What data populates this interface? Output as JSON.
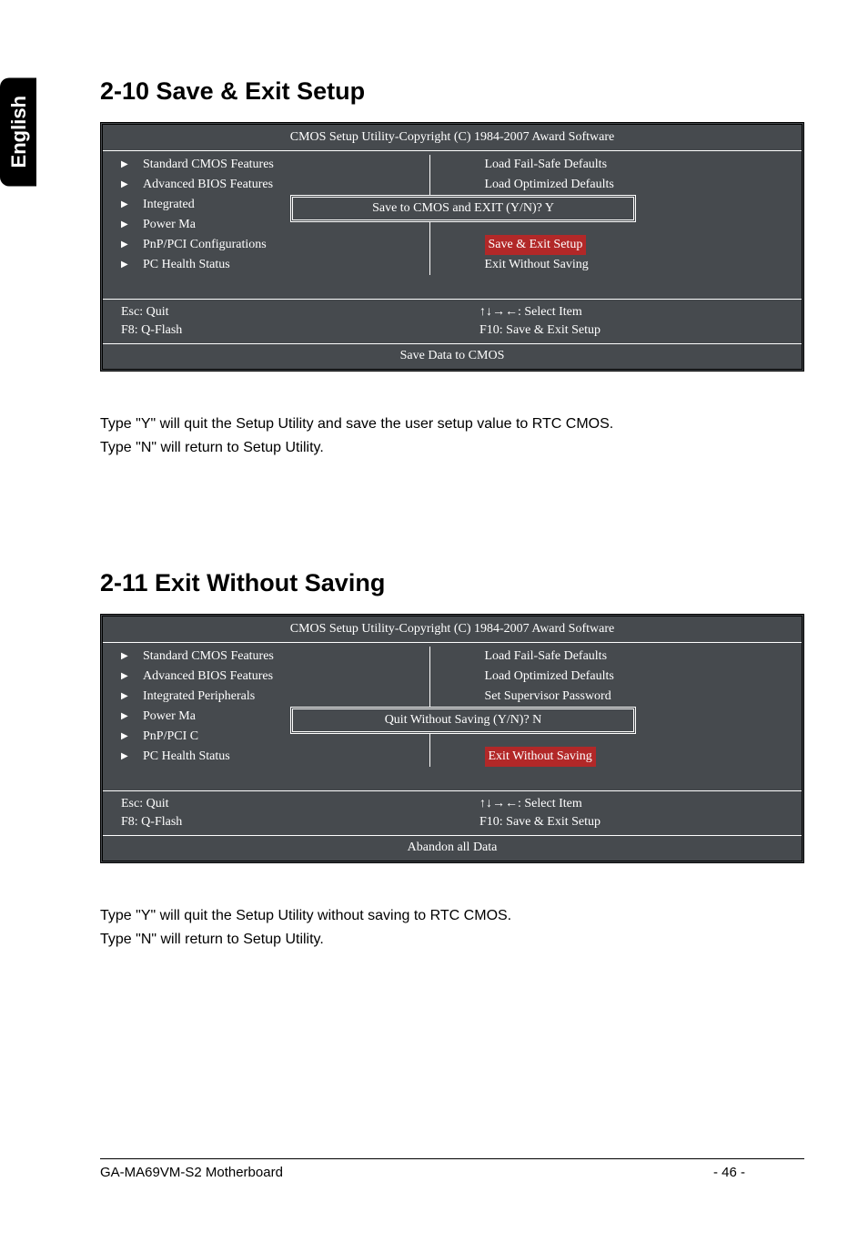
{
  "language_tab": "English",
  "section1": {
    "heading": "2-10   Save & Exit Setup",
    "bios": {
      "title": "CMOS Setup Utility-Copyright (C) 1984-2007 Award Software",
      "left_items": [
        "Standard CMOS Features",
        "Advanced BIOS Features",
        "Integrated",
        "Power Ma",
        "PnP/PCI Configurations",
        "PC Health Status"
      ],
      "right_items": [
        "Load Fail-Safe Defaults",
        "Load Optimized Defaults",
        "",
        "",
        "Save & Exit Setup",
        "Exit Without Saving"
      ],
      "dialog": "Save to CMOS and EXIT (Y/N)? Y",
      "footer_left": [
        "Esc: Quit",
        "F8: Q-Flash"
      ],
      "footer_right": [
        "↑↓→←: Select Item",
        "F10: Save & Exit Setup"
      ],
      "bottom": "Save Data to CMOS"
    },
    "text_line1": "Type \"Y\" will quit the Setup Utility and save the user setup value to RTC CMOS.",
    "text_line2": "Type \"N\" will return to Setup Utility."
  },
  "section2": {
    "heading": "2-11   Exit Without Saving",
    "bios": {
      "title": "CMOS Setup Utility-Copyright (C) 1984-2007 Award Software",
      "left_items": [
        "Standard CMOS Features",
        "Advanced BIOS Features",
        "Integrated Peripherals",
        "Power Ma",
        "PnP/PCI C",
        "PC Health Status"
      ],
      "right_items": [
        "Load Fail-Safe Defaults",
        "Load Optimized Defaults",
        "Set Supervisor Password",
        "",
        "",
        "Exit Without Saving"
      ],
      "dialog": "Quit Without Saving (Y/N)? N",
      "footer_left": [
        "Esc: Quit",
        "F8: Q-Flash"
      ],
      "footer_right": [
        "↑↓→←: Select Item",
        "F10: Save & Exit Setup"
      ],
      "bottom": "Abandon all Data"
    },
    "text_line1": "Type \"Y\" will quit the Setup Utility without saving to RTC CMOS.",
    "text_line2": "Type \"N\" will return to Setup Utility."
  },
  "footer": {
    "model": "GA-MA69VM-S2 Motherboard",
    "page": "- 46 -"
  }
}
